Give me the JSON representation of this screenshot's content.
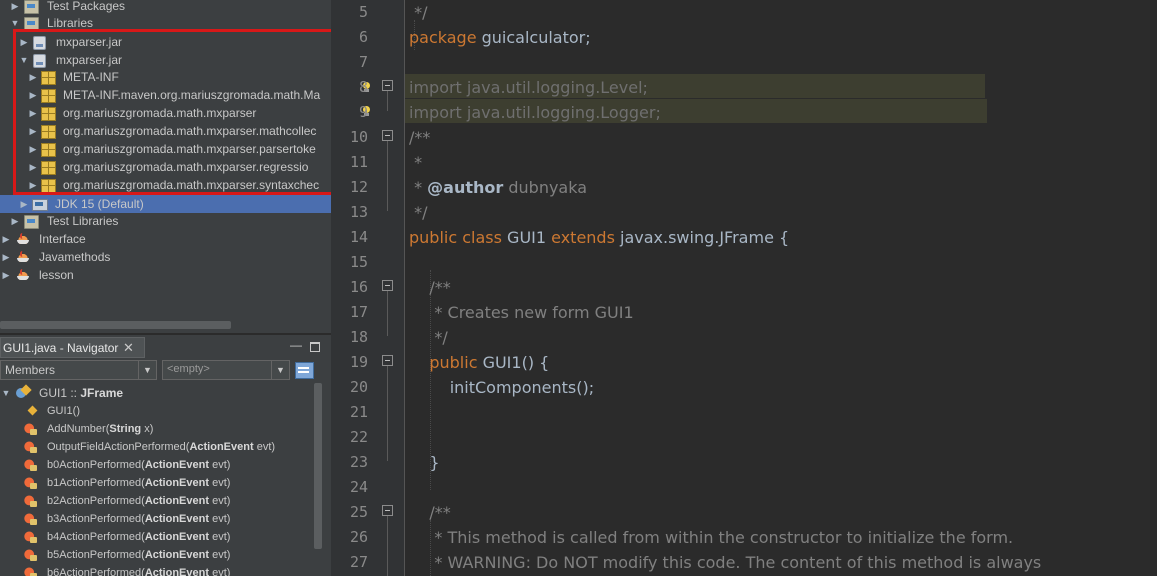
{
  "project_tree": {
    "items": [
      {
        "label": "Test Packages",
        "icon": "folder-icon"
      },
      {
        "label": "Libraries",
        "icon": "folder-icon"
      },
      {
        "label": "mxparser.jar",
        "icon": "jar-icon"
      },
      {
        "label": "mxparser.jar",
        "icon": "jar-icon"
      },
      {
        "label": "META-INF",
        "icon": "package-icon"
      },
      {
        "label": "META-INF.maven.org.mariuszgromada.math.Ma",
        "icon": "package-icon"
      },
      {
        "label": "org.mariuszgromada.math.mxparser",
        "icon": "package-icon"
      },
      {
        "label": "org.mariuszgromada.math.mxparser.mathcollec",
        "icon": "package-icon"
      },
      {
        "label": "org.mariuszgromada.math.mxparser.parsertoke",
        "icon": "package-icon"
      },
      {
        "label": "org.mariuszgromada.math.mxparser.regressio",
        "icon": "package-icon"
      },
      {
        "label": "org.mariuszgromada.math.mxparser.syntaxchec",
        "icon": "package-icon"
      },
      {
        "label": "JDK 15 (Default)",
        "icon": "jdk-icon"
      },
      {
        "label": "Test Libraries",
        "icon": "folder-icon"
      },
      {
        "label": "Interface",
        "icon": "java-project-icon"
      },
      {
        "label": "Javamethods",
        "icon": "java-project-icon"
      },
      {
        "label": "lesson",
        "icon": "java-project-icon"
      }
    ],
    "highlight_color": "#d81818",
    "selection_color": "#4b6eaf"
  },
  "navigator": {
    "tab_title": "GUI1.java - Navigator",
    "close_glyph": "✕",
    "minimize_glyph": "—",
    "members_label": "Members",
    "filter_placeholder": "<empty>",
    "class_node": {
      "name": "GUI1",
      "separator": " :: ",
      "super": "JFrame"
    },
    "constructor": "GUI1()",
    "methods": [
      {
        "name": "AddNumber(",
        "type": "String",
        "rest": " x)"
      },
      {
        "name": "OutputFieldActionPerformed(",
        "type": "ActionEvent",
        "rest": " evt)"
      },
      {
        "name": "b0ActionPerformed(",
        "type": "ActionEvent",
        "rest": " evt)"
      },
      {
        "name": "b1ActionPerformed(",
        "type": "ActionEvent",
        "rest": " evt)"
      },
      {
        "name": "b2ActionPerformed(",
        "type": "ActionEvent",
        "rest": " evt)"
      },
      {
        "name": "b3ActionPerformed(",
        "type": "ActionEvent",
        "rest": " evt)"
      },
      {
        "name": "b4ActionPerformed(",
        "type": "ActionEvent",
        "rest": " evt)"
      },
      {
        "name": "b5ActionPerformed(",
        "type": "ActionEvent",
        "rest": " evt)"
      },
      {
        "name": "b6ActionPerformed(",
        "type": "ActionEvent",
        "rest": " evt)"
      }
    ]
  },
  "editor": {
    "line_numbers": [
      "5",
      "6",
      "7",
      "8",
      "9",
      "10",
      "11",
      "12",
      "13",
      "14",
      "15",
      "16",
      "17",
      "18",
      "19",
      "20",
      "21",
      "22",
      "23",
      "24",
      "25",
      "26",
      "27"
    ],
    "lines": [
      [
        {
          "t": " */",
          "c": "cm"
        }
      ],
      [
        {
          "t": "package",
          "c": "kw"
        },
        {
          "t": " guicalculator;",
          "c": ""
        }
      ],
      [],
      [
        {
          "t": "import java.util.logging.Level;",
          "c": "dim"
        }
      ],
      [
        {
          "t": "import java.util.logging.Logger;",
          "c": "dim"
        }
      ],
      [
        {
          "t": "/**",
          "c": "cm"
        }
      ],
      [
        {
          "t": " *",
          "c": "cm"
        }
      ],
      [
        {
          "t": " * ",
          "c": "cm"
        },
        {
          "t": "@author",
          "c": "tag"
        },
        {
          "t": " dubnyaka",
          "c": "cm"
        }
      ],
      [
        {
          "t": " */",
          "c": "cm"
        }
      ],
      [
        {
          "t": "public",
          "c": "kw"
        },
        {
          "t": " ",
          "c": ""
        },
        {
          "t": "class",
          "c": "kw"
        },
        {
          "t": " GUI1 ",
          "c": ""
        },
        {
          "t": "extends",
          "c": "kw"
        },
        {
          "t": " javax.swing.JFrame {",
          "c": ""
        }
      ],
      [],
      [
        {
          "t": "    /**",
          "c": "cm"
        }
      ],
      [
        {
          "t": "     * Creates new form GUI1",
          "c": "cm"
        }
      ],
      [
        {
          "t": "     */",
          "c": "cm"
        }
      ],
      [
        {
          "t": "    public",
          "c": "kw"
        },
        {
          "t": " GUI1() {",
          "c": ""
        }
      ],
      [
        {
          "t": "        initComponents();",
          "c": ""
        }
      ],
      [],
      [],
      [
        {
          "t": "    }",
          "c": ""
        }
      ],
      [],
      [
        {
          "t": "    /**",
          "c": "cm"
        }
      ],
      [
        {
          "t": "     * This method is called from within the constructor to initialize the form.",
          "c": "cm"
        }
      ],
      [
        {
          "t": "     * WARNING: Do NOT modify this code. The content of this method is always",
          "c": "cm"
        }
      ]
    ]
  },
  "colors": {
    "keyword": "#cc7832",
    "comment": "#808080",
    "text": "#a9b7c6",
    "editor_bg": "#2b2b2b",
    "panel_bg": "#3c3f41"
  }
}
